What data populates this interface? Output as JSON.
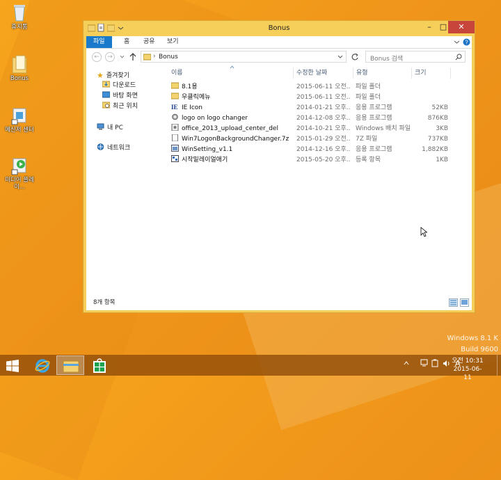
{
  "desktop": {
    "icons": [
      {
        "label": "휴지통",
        "icon": "recycle-bin-icon"
      },
      {
        "label": "Bonus",
        "icon": "folder-icon"
      },
      {
        "label": "메신저 센터",
        "icon": "messenger-icon"
      },
      {
        "label": "미디어 플레이...",
        "icon": "media-player-icon"
      }
    ],
    "watermark_line1": "Windows 8.1 K",
    "watermark_line2": "Build 9600"
  },
  "window": {
    "title": "Bonus",
    "controls": {
      "minimize": "–",
      "maximize": "□",
      "close": "✕"
    },
    "ribbon_tabs": [
      "파일",
      "홈",
      "공유",
      "보기"
    ],
    "address": "Bonus",
    "search_placeholder": "Bonus 검색",
    "nav": {
      "favorites": "즐겨찾기",
      "favorites_items": [
        "다운로드",
        "바탕 화면",
        "최근 위치"
      ],
      "this_pc": "내 PC",
      "network": "네트워크"
    },
    "columns": [
      "이름",
      "수정한 날짜",
      "유형",
      "크기"
    ],
    "files": [
      {
        "name": "8.1용",
        "date": "2015-06-11 오전...",
        "type": "파일 폴더",
        "size": "",
        "icon": "folder-icon"
      },
      {
        "name": "우클릭메뉴",
        "date": "2015-06-11 오전...",
        "type": "파일 폴더",
        "size": "",
        "icon": "folder-icon"
      },
      {
        "name": "IE Icon",
        "date": "2014-01-21 오후...",
        "type": "응용 프로그램",
        "size": "52KB",
        "icon": "ie-app-icon"
      },
      {
        "name": "logo on logo changer",
        "date": "2014-12-08 오후...",
        "type": "응용 프로그램",
        "size": "876KB",
        "icon": "gear-app-icon"
      },
      {
        "name": "office_2013_upload_center_del",
        "date": "2014-10-21 오후...",
        "type": "Windows 배치 파일",
        "size": "3KB",
        "icon": "batch-file-icon"
      },
      {
        "name": "Win7LogonBackgroundChanger.7z",
        "date": "2015-01-29 오전...",
        "type": "7Z 파일",
        "size": "737KB",
        "icon": "archive-file-icon"
      },
      {
        "name": "WinSetting_v1.1",
        "date": "2014-12-16 오후...",
        "type": "응용 프로그램",
        "size": "1,882KB",
        "icon": "app-icon"
      },
      {
        "name": "시작밑레이얼애기",
        "date": "2015-05-20 오후...",
        "type": "등록 항목",
        "size": "1KB",
        "icon": "registry-file-icon"
      }
    ],
    "status": "8개 항목"
  },
  "taskbar": {
    "time": "오전 10:31",
    "date": "2015-06-11",
    "ime": "A"
  },
  "colors": {
    "accent": "#1979ca",
    "window_border": "#f6cf5b",
    "close": "#c7453a"
  }
}
